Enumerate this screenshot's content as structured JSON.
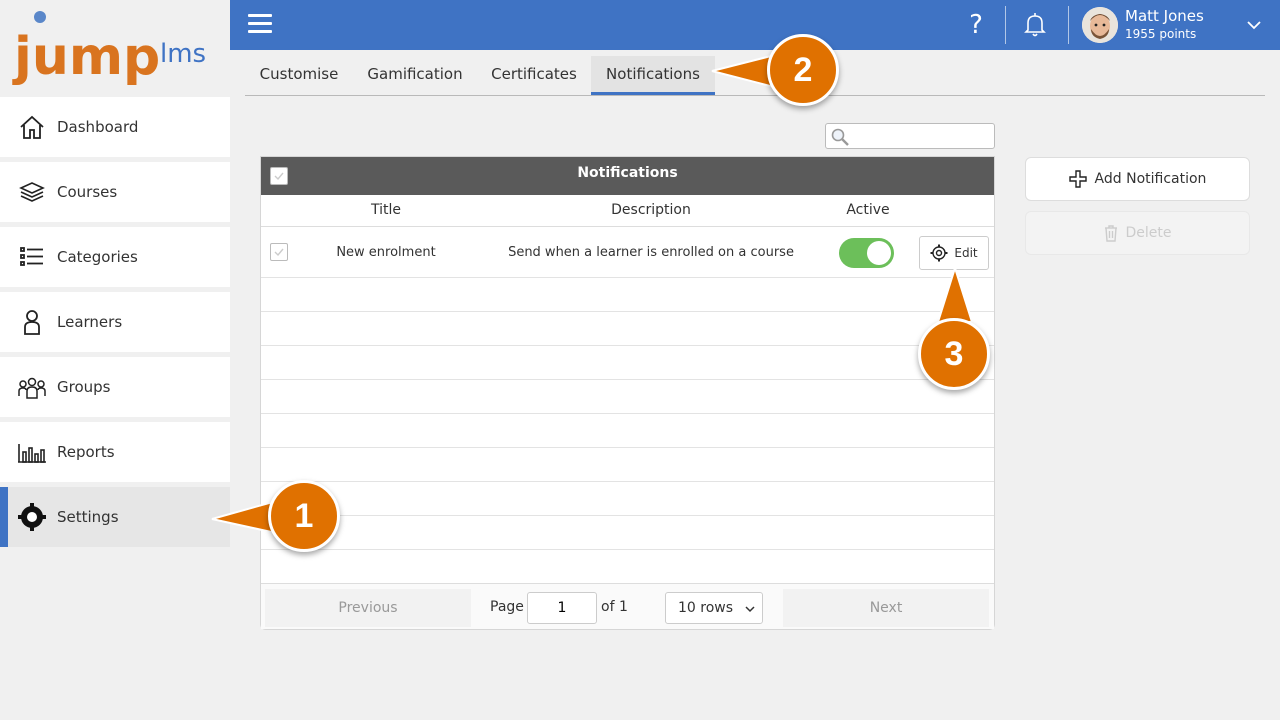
{
  "logo": {
    "text_jump": "jump",
    "text_lms": "lms"
  },
  "sidebar": {
    "items": [
      {
        "label": "Dashboard",
        "icon": "home-icon"
      },
      {
        "label": "Courses",
        "icon": "books-icon"
      },
      {
        "label": "Categories",
        "icon": "list-icon"
      },
      {
        "label": "Learners",
        "icon": "person-icon"
      },
      {
        "label": "Groups",
        "icon": "group-icon"
      },
      {
        "label": "Reports",
        "icon": "bar-chart-icon"
      },
      {
        "label": "Settings",
        "icon": "gear-icon",
        "active": true
      }
    ]
  },
  "topbar": {
    "help_glyph": "?",
    "user": {
      "name": "Matt Jones",
      "points": "1955 points"
    }
  },
  "tabs": [
    {
      "label": "Customise"
    },
    {
      "label": "Gamification"
    },
    {
      "label": "Certificates"
    },
    {
      "label": "Notifications",
      "active": true
    }
  ],
  "search": {
    "placeholder": "",
    "value": ""
  },
  "grid": {
    "title": "Notifications",
    "columns": {
      "title": "Title",
      "description": "Description",
      "active": "Active"
    },
    "rows": [
      {
        "title": "New enrolment",
        "description": "Send when a learner is enrolled on a course",
        "active": true,
        "edit_label": "Edit"
      }
    ],
    "pager": {
      "previous": "Previous",
      "page_label": "Page",
      "page_value": "1",
      "of_label": "of 1",
      "rows_option": "10 rows",
      "next": "Next"
    }
  },
  "actions": {
    "add_label": "Add Notification",
    "delete_label": "Delete"
  },
  "callouts": {
    "one": "1",
    "two": "2",
    "three": "3"
  },
  "colors": {
    "brand_blue": "#3f73c4",
    "callout_orange": "#e07100",
    "toggle_green": "#6cbf5a",
    "grid_header": "#5a5a5a"
  }
}
